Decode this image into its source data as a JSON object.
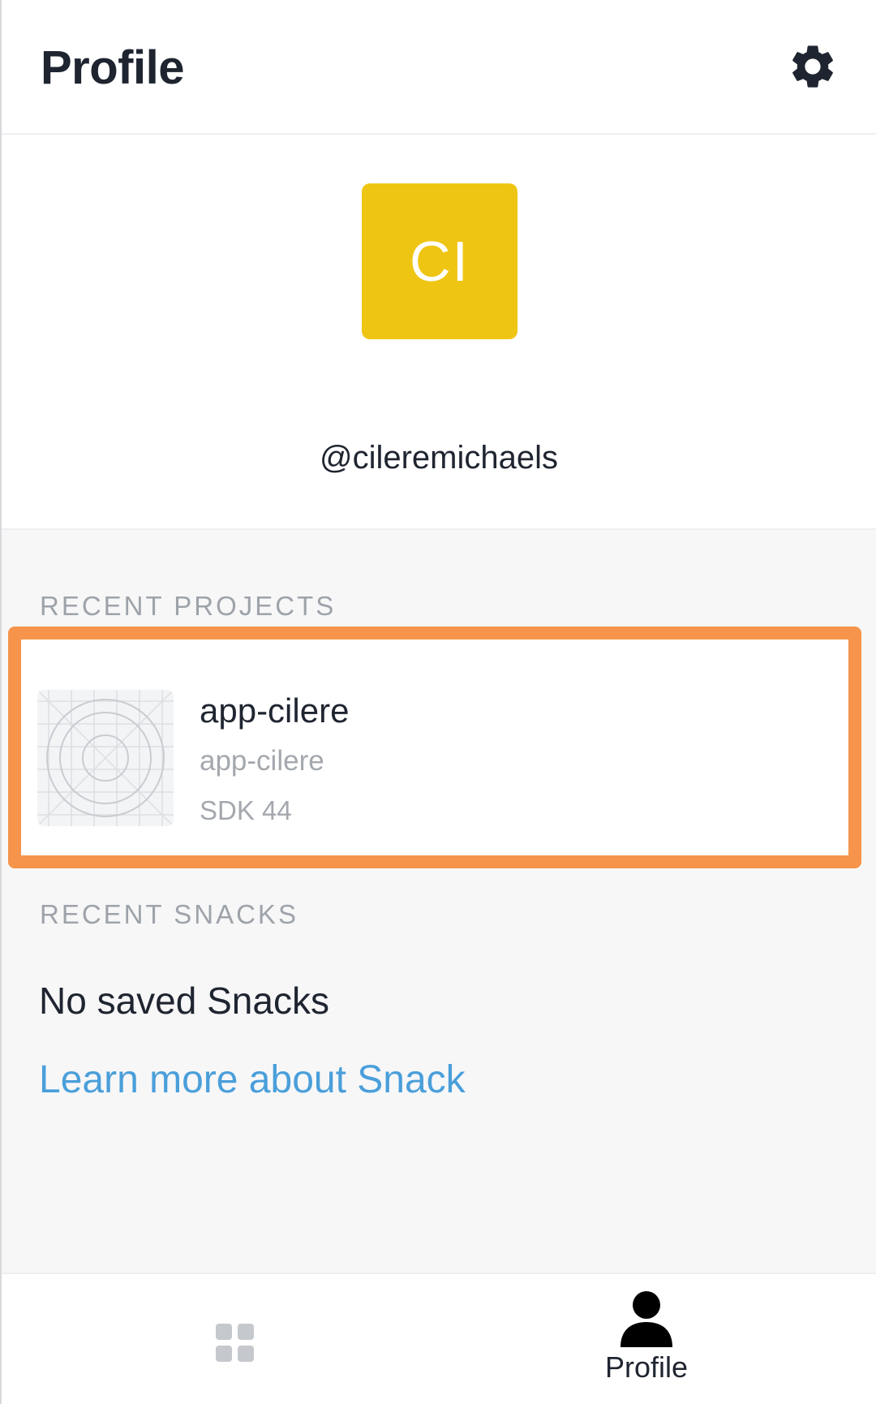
{
  "header": {
    "title": "Profile",
    "settings_icon": "gear-icon"
  },
  "profile": {
    "avatar_initials": "CI",
    "avatar_color": "#efc514",
    "username": "@cileremichaels"
  },
  "recent_projects": {
    "heading": "RECENT PROJECTS",
    "highlight_color": "#f5944a",
    "items": [
      {
        "name": "app-cilere",
        "slug": "app-cilere",
        "sdk": "SDK 44",
        "icon": "app-placeholder-icon"
      }
    ]
  },
  "recent_snacks": {
    "heading": "RECENT SNACKS",
    "empty_message": "No saved Snacks",
    "link_label": "Learn more about Snack",
    "link_color": "#4a9fda"
  },
  "tabbar": {
    "tabs": [
      {
        "id": "projects",
        "icon": "grid-icon",
        "label": "",
        "active": false
      },
      {
        "id": "profile",
        "icon": "person-icon",
        "label": "Profile",
        "active": true
      }
    ]
  }
}
